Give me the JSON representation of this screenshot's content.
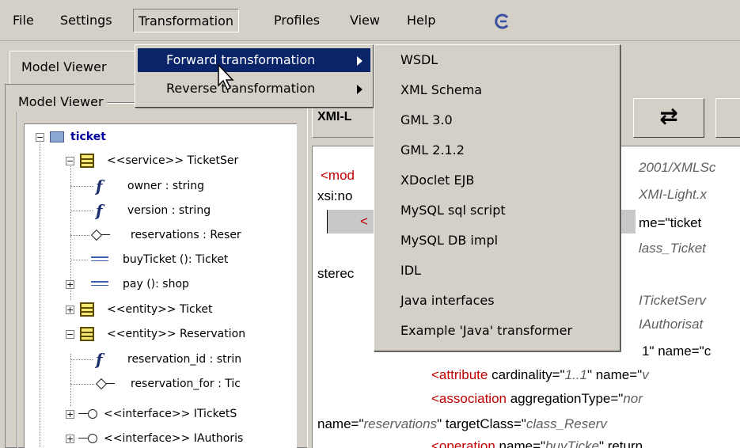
{
  "menubar": {
    "items": [
      "File",
      "Settings",
      "Transformation",
      "Profiles",
      "View",
      "Help"
    ]
  },
  "tabs": {
    "model_viewer": "Model Viewer"
  },
  "left_panel": {
    "legend": "Model Viewer"
  },
  "tree": [
    {
      "label": "ticket",
      "icon": "folder-icon",
      "expander": "−"
    },
    {
      "label": "<<service>> TicketSer",
      "icon": "class-icon",
      "expander": "−"
    },
    {
      "label": "owner : string",
      "icon": "attribute-icon"
    },
    {
      "label": "version : string",
      "icon": "attribute-icon"
    },
    {
      "label": "reservations : Reser",
      "icon": "association-icon"
    },
    {
      "label": "buyTicket (): Ticket",
      "icon": "operation-icon"
    },
    {
      "label": "pay (): shop",
      "icon": "operation-icon",
      "expander": "+"
    },
    {
      "label": "<<entity>> Ticket",
      "icon": "class-icon",
      "expander": "+"
    },
    {
      "label": "<<entity>> Reservation",
      "icon": "class-icon",
      "expander": "−"
    },
    {
      "label": "reservation_id : strin",
      "icon": "attribute-icon"
    },
    {
      "label": "reservation_for : Tic",
      "icon": "association-icon"
    },
    {
      "label": "<<interface>> ITicketS",
      "icon": "interface-icon",
      "expander": "+"
    },
    {
      "label": "<<interface>> IAuthoris",
      "icon": "interface-icon",
      "expander": "+"
    }
  ],
  "xmi": {
    "title": "XMI-L",
    "swap_label": "⇄",
    "lines": {
      "l1_tag": "<mod",
      "l1_tail": "2001/XMLSc",
      "l2_head": "xsi:no",
      "l2_tail": "XMI-Light.x",
      "l3_lt": "<",
      "l3_tail": "me=\"ticket",
      "l4_tail": "lass_Ticket",
      "l5_head": "sterec",
      "l6_tail": "ITicketServ",
      "l7_tail": "IAuthorisat",
      "l8_tail": "1\" name=\"c",
      "l9_lt": "<attribute",
      "l9_a": " cardinality=\"",
      "l9_v": "1..1",
      "l9_b": "\" name=\"",
      "l9_v2": "v",
      "l10_lt": "<association",
      "l10_a": " aggregationType=\"",
      "l10_v": "nor",
      "l11_a": "name=\"",
      "l11_v": "reservations",
      "l11_b": "\" targetClass=\"",
      "l11_v2": "class_Reserv",
      "l12_lt": "<operation",
      "l12_a": " name=\"",
      "l12_v": "buyTicke",
      "l12_b": "\" return"
    }
  },
  "transformation_menu": {
    "items": [
      {
        "label": "Forward transformation",
        "selected": true
      },
      {
        "label": "Reverse transformation",
        "selected": false
      }
    ]
  },
  "forward_submenu": {
    "items": [
      "WSDL",
      "XML Schema",
      "GML 3.0",
      "GML 2.1.2",
      "XDoclet EJB",
      "MySQL sql script",
      "MySQL DB impl",
      "IDL",
      "Java interfaces",
      "Example 'Java' transformer"
    ]
  },
  "colors": {
    "menu_selected_bg": "#0a246a",
    "window_bg": "#d4d0c8",
    "xml_tag": "#c00000"
  }
}
